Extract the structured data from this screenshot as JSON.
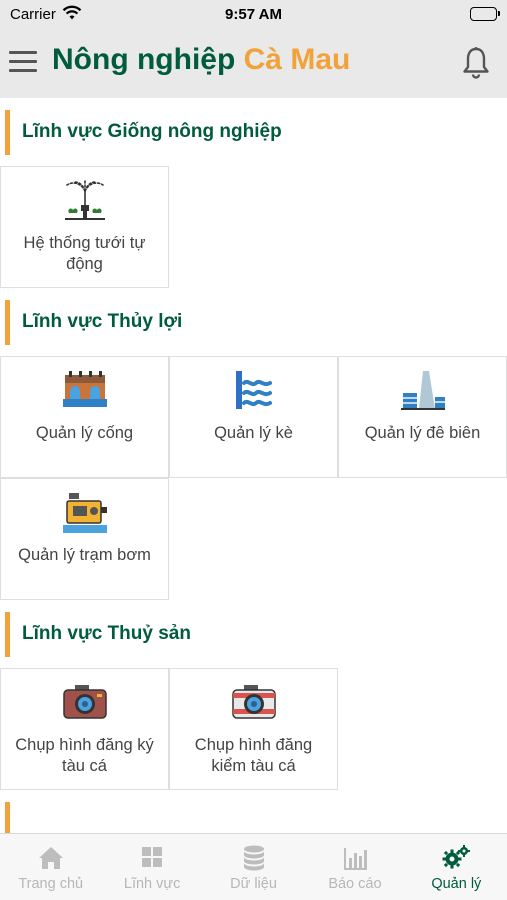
{
  "status_bar": {
    "carrier": "Carrier",
    "time": "9:57 AM"
  },
  "header": {
    "title_part1": "Nông nghiệp",
    "title_part2": "Cà Mau"
  },
  "sections": [
    {
      "title": "Lĩnh vực Giống nông nghiệp",
      "items": [
        {
          "label": "Hệ thống tưới tự động",
          "icon": "sprinkler-icon"
        }
      ]
    },
    {
      "title": "Lĩnh vực Thủy lợi",
      "items": [
        {
          "label": "Quản lý cống",
          "icon": "sluice-gate-icon"
        },
        {
          "label": "Quản lý kè",
          "icon": "embankment-icon"
        },
        {
          "label": "Quản lý đê biên",
          "icon": "dike-icon"
        },
        {
          "label": "Quản lý trạm bơm",
          "icon": "pump-station-icon"
        }
      ]
    },
    {
      "title": "Lĩnh vực Thuỷ sản",
      "items": [
        {
          "label": "Chụp hình đăng ký tàu cá",
          "icon": "camera-icon"
        },
        {
          "label": "Chụp hình đăng kiểm tàu cá",
          "icon": "camera-icon"
        }
      ]
    }
  ],
  "tabbar": {
    "active": "Quản lý",
    "tabs": [
      {
        "label": "Trang chủ",
        "icon": "home-icon"
      },
      {
        "label": "Lĩnh vực",
        "icon": "grid-icon"
      },
      {
        "label": "Dữ liệu",
        "icon": "database-icon"
      },
      {
        "label": "Báo cáo",
        "icon": "chart-icon"
      },
      {
        "label": "Quản lý",
        "icon": "gears-icon"
      }
    ]
  },
  "colors": {
    "brand_green": "#005c3c",
    "accent_orange": "#f2a23a",
    "header_bg": "#e9e9e9"
  }
}
